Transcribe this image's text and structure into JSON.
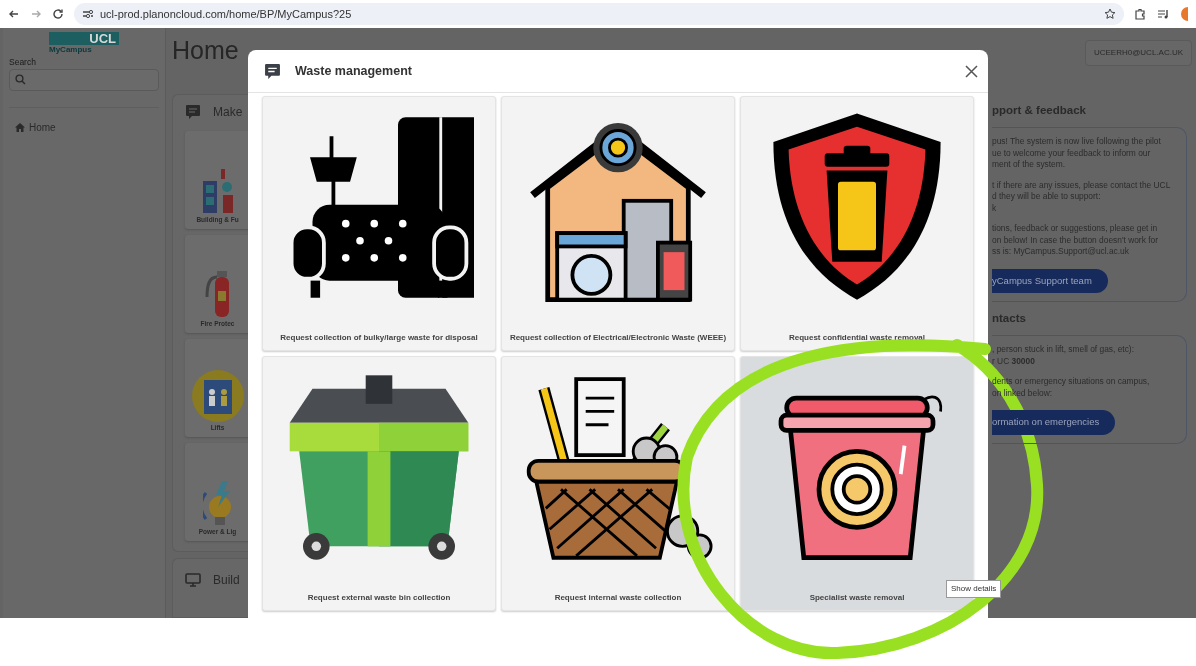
{
  "browser": {
    "url": "ucl-prod.planoncloud.com/home/BP/MyCampus?25"
  },
  "sidebar": {
    "logo": "UCL",
    "logo_sub": "MyCampus",
    "search_label": "Search",
    "items": [
      {
        "label": "Home"
      }
    ]
  },
  "page": {
    "title": "Home",
    "user": "UCEERH0@UCL.AC.UK"
  },
  "requests_panel": {
    "title": "Make",
    "tiles": [
      {
        "label": "Building & Fu",
        "kind": "building"
      },
      {
        "label": "Fire Protec",
        "kind": "extinguisher"
      },
      {
        "label": "Lifts",
        "kind": "lift"
      },
      {
        "label": "Power & Lig",
        "kind": "bulb"
      }
    ]
  },
  "second_panel": {
    "title": "Build"
  },
  "support_panel": {
    "title": "pport & feedback",
    "paragraphs": [
      [
        "pus! The system is now live following the pilot",
        "ue to welcome your feedback to inform our",
        "ment of the system."
      ],
      [
        "t if there are any issues, please contact the UCL",
        "d they will be able to support:",
        "k"
      ],
      [
        "tions, feedback or suggestions, please get in",
        "on below! In case the button doesn't work for",
        "ss is: MyCampus.Support@ucl.ac.uk"
      ]
    ],
    "button": "yCampus Support team"
  },
  "contacts_panel": {
    "title": "ntacts",
    "paragraphs": [
      [
        ", person stuck in lift, smell of gas, etc):",
        "r UC **30000**"
      ],
      [
        "dents or emergency situations on campus,",
        "on linked below:"
      ]
    ],
    "button": "ormation on emergencies"
  },
  "modal": {
    "title": "Waste management",
    "tiles": [
      {
        "label": "Request collection of bulky/large waste for disposal",
        "kind": "sofa",
        "hovered": false
      },
      {
        "label": "Request collection of Electrical/Electronic Waste (WEEE)",
        "kind": "appliances",
        "hovered": false
      },
      {
        "label": "Request confidential waste removal",
        "kind": "shield",
        "hovered": false
      },
      {
        "label": "Request external waste bin collection",
        "kind": "wheelie-bin",
        "hovered": false
      },
      {
        "label": "Request internal waste collection",
        "kind": "basket",
        "hovered": false
      },
      {
        "label": "Specialist waste removal",
        "kind": "cup",
        "hovered": true
      }
    ],
    "tooltip": "Show details"
  }
}
